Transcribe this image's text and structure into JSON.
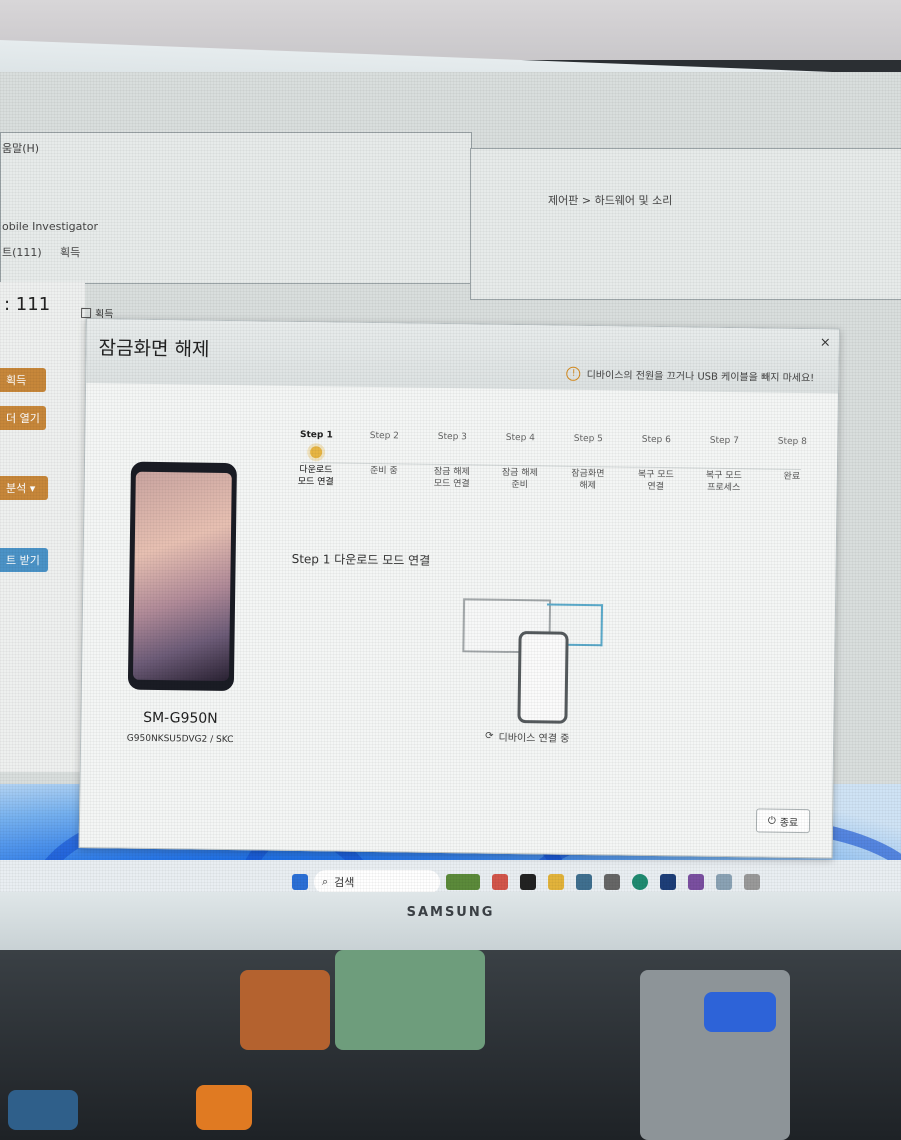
{
  "dialog": {
    "window_label": "획득",
    "title": "잠금화면 해제",
    "warning": "디바이스의 전원을 끄거나 USB 케이블을 빼지 마세요!",
    "close_glyph": "×",
    "device": {
      "model": "SM-G950N",
      "firmware": "G950NKSU5DVG2 / SKC"
    },
    "steps": [
      {
        "head": "Step 1",
        "label": "다운로드\n모드 연결",
        "active": true
      },
      {
        "head": "Step 2",
        "label": "준비 중",
        "active": false
      },
      {
        "head": "Step 3",
        "label": "잠금 해제\n모드 연결",
        "active": false
      },
      {
        "head": "Step 4",
        "label": "잠금 해제\n준비",
        "active": false
      },
      {
        "head": "Step 5",
        "label": "잠금화면\n해제",
        "active": false
      },
      {
        "head": "Step 6",
        "label": "복구 모드\n연결",
        "active": false
      },
      {
        "head": "Step 7",
        "label": "복구 모드\n프로세스",
        "active": false
      },
      {
        "head": "Step 8",
        "label": "완료",
        "active": false
      }
    ],
    "current_step_text": "Step 1   다운로드 모드 연결",
    "status": "디바이스 연결 중",
    "end_button": "종료"
  },
  "background": {
    "menu_text": "움말(H)",
    "app_text": "obile Investigator",
    "tab_text": "트(111)",
    "tab_text2": "획득",
    "path_text": "제어판 > 하드웨어 및 소리",
    "count_text": ": 111",
    "side_buttons": [
      "획득",
      "더 열기",
      "분석 ▾",
      "트 받기"
    ]
  },
  "taskbar": {
    "search_label": "검색"
  },
  "monitor": {
    "brand": "SAMSUNG"
  },
  "colors": {
    "accent_orange": "#c7873a",
    "accent_blue": "#4b93c7",
    "active_step": "#e7b544"
  }
}
